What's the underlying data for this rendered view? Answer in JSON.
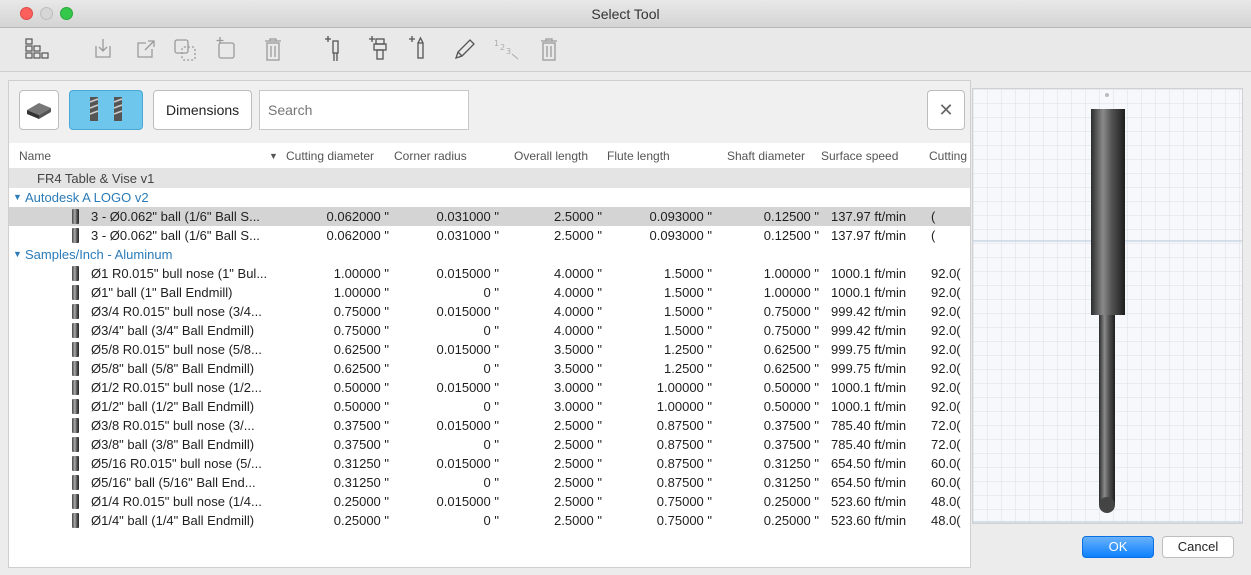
{
  "window": {
    "title": "Select Tool"
  },
  "toolbar": {
    "icons": [
      "tool-library-icon",
      "import-icon",
      "export-icon",
      "copy-icon",
      "new-library-icon",
      "delete-library-icon",
      "new-mill-tool-icon",
      "new-holder-icon",
      "new-tool-icon",
      "edit-icon",
      "renumber-icon",
      "delete-tool-icon"
    ]
  },
  "filter": {
    "dimensions_label": "Dimensions",
    "search_placeholder": "Search",
    "clear_label": "✕"
  },
  "columns": [
    "Name",
    "Cutting diameter",
    "Corner radius",
    "Overall length",
    "Flute length",
    "Shaft diameter",
    "Surface speed",
    "Cutting"
  ],
  "library": "FR4 Table & Vise v1",
  "groups": [
    {
      "name": "Autodesk A LOGO v2",
      "tools": [
        {
          "name": "3 - Ø0.062\" ball (1/6\" Ball S...",
          "cutting_diameter": "0.062000 \"",
          "corner_radius": "0.031000 \"",
          "overall_length": "2.5000 \"",
          "flute_length": "0.093000 \"",
          "shaft_diameter": "0.12500 \"",
          "surface_speed": "137.97 ft/min",
          "cutting": "(",
          "selected": true
        },
        {
          "name": "3 - Ø0.062\" ball (1/6\" Ball S...",
          "cutting_diameter": "0.062000 \"",
          "corner_radius": "0.031000 \"",
          "overall_length": "2.5000 \"",
          "flute_length": "0.093000 \"",
          "shaft_diameter": "0.12500 \"",
          "surface_speed": "137.97 ft/min",
          "cutting": "("
        }
      ]
    },
    {
      "name": "Samples/Inch - Aluminum",
      "tools": [
        {
          "name": "Ø1 R0.015\" bull nose (1\" Bul...",
          "cutting_diameter": "1.00000 \"",
          "corner_radius": "0.015000 \"",
          "overall_length": "4.0000 \"",
          "flute_length": "1.5000 \"",
          "shaft_diameter": "1.00000 \"",
          "surface_speed": "1000.1 ft/min",
          "cutting": "92.0("
        },
        {
          "name": "Ø1\" ball (1\" Ball Endmill)",
          "cutting_diameter": "1.00000 \"",
          "corner_radius": "0 \"",
          "overall_length": "4.0000 \"",
          "flute_length": "1.5000 \"",
          "shaft_diameter": "1.00000 \"",
          "surface_speed": "1000.1 ft/min",
          "cutting": "92.0("
        },
        {
          "name": "Ø3/4 R0.015\" bull nose (3/4...",
          "cutting_diameter": "0.75000 \"",
          "corner_radius": "0.015000 \"",
          "overall_length": "4.0000 \"",
          "flute_length": "1.5000 \"",
          "shaft_diameter": "0.75000 \"",
          "surface_speed": "999.42 ft/min",
          "cutting": "92.0("
        },
        {
          "name": "Ø3/4\" ball (3/4\" Ball Endmill)",
          "cutting_diameter": "0.75000 \"",
          "corner_radius": "0 \"",
          "overall_length": "4.0000 \"",
          "flute_length": "1.5000 \"",
          "shaft_diameter": "0.75000 \"",
          "surface_speed": "999.42 ft/min",
          "cutting": "92.0("
        },
        {
          "name": "Ø5/8 R0.015\" bull nose (5/8...",
          "cutting_diameter": "0.62500 \"",
          "corner_radius": "0.015000 \"",
          "overall_length": "3.5000 \"",
          "flute_length": "1.2500 \"",
          "shaft_diameter": "0.62500 \"",
          "surface_speed": "999.75 ft/min",
          "cutting": "92.0("
        },
        {
          "name": "Ø5/8\" ball (5/8\" Ball Endmill)",
          "cutting_diameter": "0.62500 \"",
          "corner_radius": "0 \"",
          "overall_length": "3.5000 \"",
          "flute_length": "1.2500 \"",
          "shaft_diameter": "0.62500 \"",
          "surface_speed": "999.75 ft/min",
          "cutting": "92.0("
        },
        {
          "name": "Ø1/2 R0.015\" bull nose (1/2...",
          "cutting_diameter": "0.50000 \"",
          "corner_radius": "0.015000 \"",
          "overall_length": "3.0000 \"",
          "flute_length": "1.00000 \"",
          "shaft_diameter": "0.50000 \"",
          "surface_speed": "1000.1 ft/min",
          "cutting": "92.0("
        },
        {
          "name": "Ø1/2\" ball (1/2\" Ball Endmill)",
          "cutting_diameter": "0.50000 \"",
          "corner_radius": "0 \"",
          "overall_length": "3.0000 \"",
          "flute_length": "1.00000 \"",
          "shaft_diameter": "0.50000 \"",
          "surface_speed": "1000.1 ft/min",
          "cutting": "92.0("
        },
        {
          "name": "Ø3/8 R0.015\" bull nose (3/...",
          "cutting_diameter": "0.37500 \"",
          "corner_radius": "0.015000 \"",
          "overall_length": "2.5000 \"",
          "flute_length": "0.87500 \"",
          "shaft_diameter": "0.37500 \"",
          "surface_speed": "785.40 ft/min",
          "cutting": "72.0("
        },
        {
          "name": "Ø3/8\" ball (3/8\" Ball Endmill)",
          "cutting_diameter": "0.37500 \"",
          "corner_radius": "0 \"",
          "overall_length": "2.5000 \"",
          "flute_length": "0.87500 \"",
          "shaft_diameter": "0.37500 \"",
          "surface_speed": "785.40 ft/min",
          "cutting": "72.0("
        },
        {
          "name": "Ø5/16 R0.015\" bull nose (5/...",
          "cutting_diameter": "0.31250 \"",
          "corner_radius": "0.015000 \"",
          "overall_length": "2.5000 \"",
          "flute_length": "0.87500 \"",
          "shaft_diameter": "0.31250 \"",
          "surface_speed": "654.50 ft/min",
          "cutting": "60.0("
        },
        {
          "name": "Ø5/16\" ball (5/16\" Ball End...",
          "cutting_diameter": "0.31250 \"",
          "corner_radius": "0 \"",
          "overall_length": "2.5000 \"",
          "flute_length": "0.87500 \"",
          "shaft_diameter": "0.31250 \"",
          "surface_speed": "654.50 ft/min",
          "cutting": "60.0("
        },
        {
          "name": "Ø1/4 R0.015\" bull nose (1/4...",
          "cutting_diameter": "0.25000 \"",
          "corner_radius": "0.015000 \"",
          "overall_length": "2.5000 \"",
          "flute_length": "0.75000 \"",
          "shaft_diameter": "0.25000 \"",
          "surface_speed": "523.60 ft/min",
          "cutting": "48.0("
        },
        {
          "name": "Ø1/4\" ball (1/4\" Ball Endmill)",
          "cutting_diameter": "0.25000 \"",
          "corner_radius": "0 \"",
          "overall_length": "2.5000 \"",
          "flute_length": "0.75000 \"",
          "shaft_diameter": "0.25000 \"",
          "surface_speed": "523.60 ft/min",
          "cutting": "48.0("
        }
      ]
    }
  ],
  "buttons": {
    "ok": "OK",
    "cancel": "Cancel"
  },
  "colors": {
    "accent": "#0d81ff",
    "category": "#2a7bb8",
    "filter_active": "#6fc6ec",
    "close": "#fc605c",
    "zoom": "#34c84a"
  }
}
